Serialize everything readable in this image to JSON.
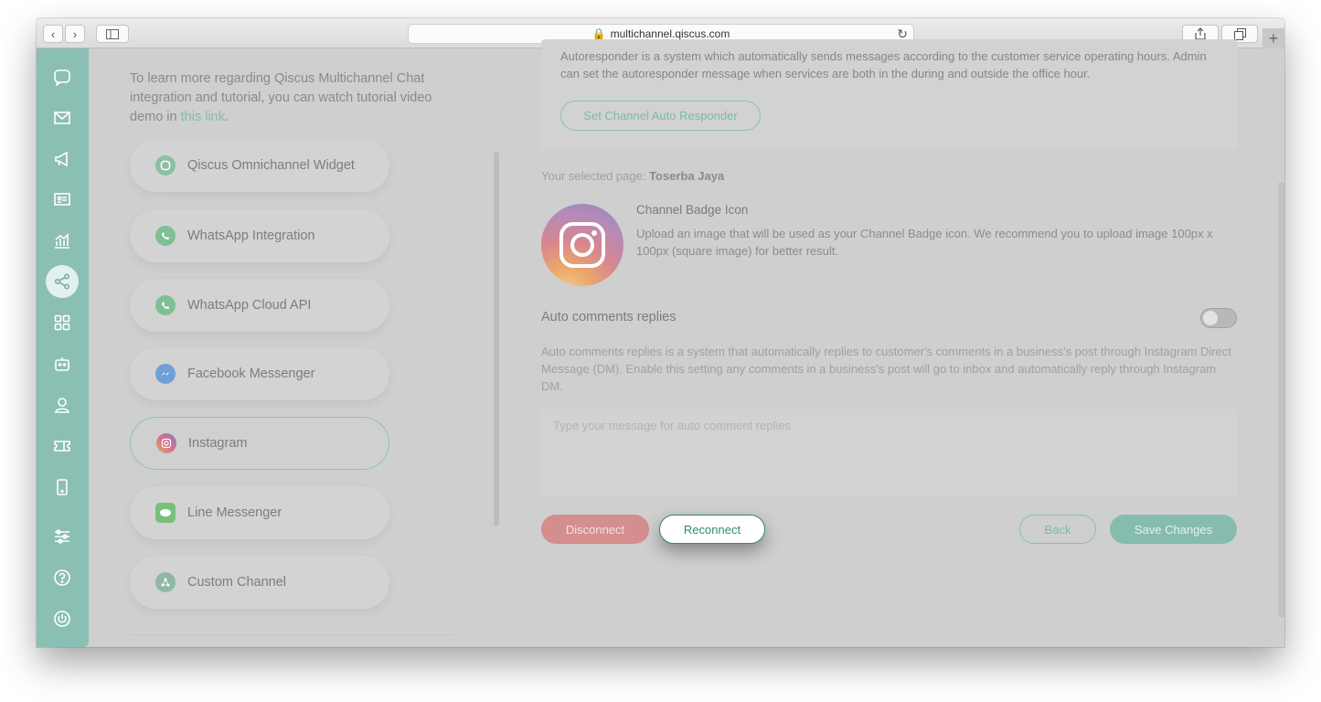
{
  "browser": {
    "url": "multichannel.qiscus.com",
    "back_icon": "chevron-left-icon",
    "forward_icon": "chevron-right-icon",
    "new_tab_label": "+"
  },
  "colors": {
    "brand": "#8bbfb4",
    "disconnect": "#d48e8e",
    "reconnect_text": "#2f8a74"
  },
  "sidebar": {
    "items": [
      {
        "icon": "chat-bubble-icon"
      },
      {
        "icon": "mail-icon"
      },
      {
        "icon": "megaphone-icon"
      },
      {
        "icon": "contact-card-icon"
      },
      {
        "icon": "analytics-icon"
      },
      {
        "icon": "share-nodes-icon",
        "active": true
      },
      {
        "icon": "apps-grid-icon"
      },
      {
        "icon": "bot-icon"
      },
      {
        "icon": "agent-icon"
      },
      {
        "icon": "ticket-icon"
      },
      {
        "icon": "mobile-icon"
      },
      {
        "icon": "settings-sliders-icon"
      },
      {
        "icon": "help-icon"
      },
      {
        "icon": "power-icon"
      }
    ]
  },
  "intro": {
    "text": "To learn more regarding Qiscus Multichannel Chat integration and tutorial, you can watch tutorial video demo in",
    "link_text": "this link",
    "suffix": "."
  },
  "channels": [
    {
      "label": "Qiscus Omnichannel Widget",
      "icon": "qiscus-widget-icon"
    },
    {
      "label": "WhatsApp Integration",
      "icon": "whatsapp-icon"
    },
    {
      "label": "WhatsApp Cloud API",
      "icon": "whatsapp-icon"
    },
    {
      "label": "Facebook Messenger",
      "icon": "messenger-icon"
    },
    {
      "label": "Instagram",
      "icon": "instagram-icon",
      "active": true
    },
    {
      "label": "Line Messenger",
      "icon": "line-icon"
    },
    {
      "label": "Custom Channel",
      "icon": "custom-channel-icon"
    }
  ],
  "autoresponder": {
    "description": "Autoresponder is a system which automatically sends messages according to the customer service operating hours. Admin can set the autoresponder message when services are both in the during and outside the office hour.",
    "button": "Set Channel Auto Responder"
  },
  "selected_page": {
    "label": "Your selected page:",
    "value": "Toserba Jaya"
  },
  "badge": {
    "title": "Channel Badge Icon",
    "description": "Upload an image that will be used as your Channel Badge icon. We recommend you to upload image 100px x 100px (square image) for better result."
  },
  "auto_comments": {
    "title": "Auto comments replies",
    "enabled": false,
    "description": "Auto comments replies is a system that automatically replies to customer's comments in a business's post through Instagram Direct Message (DM). Enable this setting any comments in a business's post will go to inbox and automatically reply through Instagram DM.",
    "placeholder": "Type your message for auto comment replies"
  },
  "actions": {
    "disconnect": "Disconnect",
    "reconnect": "Reconnect",
    "back": "Back",
    "save": "Save Changes"
  }
}
